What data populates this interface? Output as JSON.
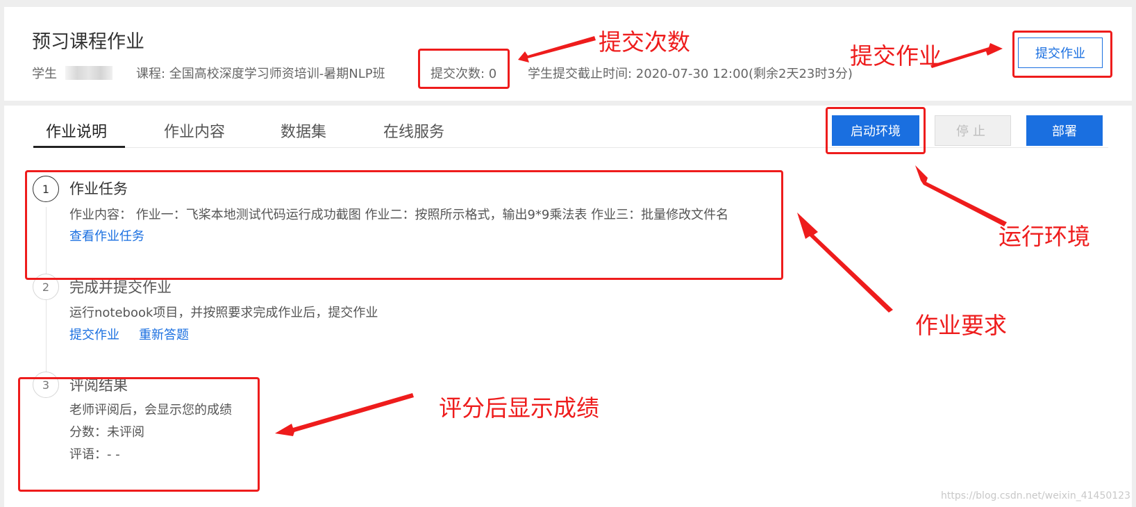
{
  "header": {
    "title": "预习课程作业",
    "student_label": "学生",
    "course": "课程: 全国高校深度学习师资培训-暑期NLP班",
    "submit_count": "提交次数: 0",
    "deadline": "学生提交截止时间: 2020-07-30 12:00(剩余2天23时3分)",
    "submit_button": "提交作业"
  },
  "tabs": [
    {
      "label": "作业说明",
      "active": true
    },
    {
      "label": "作业内容",
      "active": false
    },
    {
      "label": "数据集",
      "active": false
    },
    {
      "label": "在线服务",
      "active": false
    }
  ],
  "toolbar": {
    "start_env": "启动环境",
    "stop": "停止",
    "deploy": "部署"
  },
  "steps": [
    {
      "number": "1",
      "title": "作业任务",
      "text": "作业内容： 作业一：飞桨本地测试代码运行成功截图 作业二：按照所示格式，输出9*9乘法表 作业三：批量修改文件名",
      "links": [
        "查看作业任务"
      ]
    },
    {
      "number": "2",
      "title": "完成并提交作业",
      "text": "运行notebook项目，并按照要求完成作业后，提交作业",
      "links": [
        "提交作业",
        "重新答题"
      ]
    },
    {
      "number": "3",
      "title": "评阅结果",
      "lines": [
        "老师评阅后，会显示您的成绩",
        "分数：未评阅",
        "评语：- -"
      ]
    }
  ],
  "annotations": {
    "submit_count": "提交次数",
    "submit_homework": "提交作业",
    "run_env": "运行环境",
    "requirements": "作业要求",
    "grade": "评分后显示成绩",
    "color": "#ee1c1c"
  },
  "colors": {
    "accent": "#1a6fe0",
    "annotation_red": "#ee1c1c"
  },
  "watermark": "https://blog.csdn.net/weixin_41450123"
}
